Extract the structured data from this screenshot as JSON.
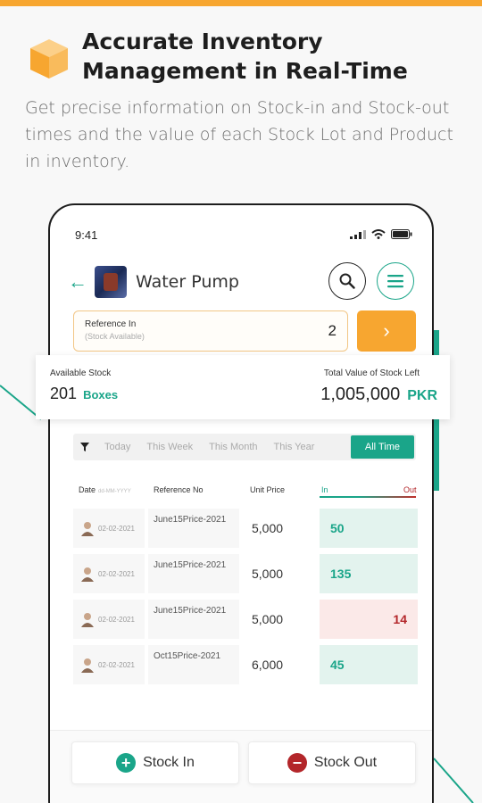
{
  "promo": {
    "headline_line1": "Accurate Inventory",
    "headline_line2": "Management in Real-Time",
    "subhead": "Get precise information on Stock-in and Stock-out times and the value of each Stock Lot and Product in inventory."
  },
  "phone": {
    "status_time": "9:41",
    "header": {
      "title": "Water Pump"
    },
    "reference": {
      "label": "Reference In",
      "sublabel": "(Stock Available)",
      "value": "2"
    },
    "stock": {
      "available_label": "Available Stock",
      "available_value": "201",
      "available_unit": "Boxes",
      "total_label": "Total Value of Stock Left",
      "total_value": "1,005,000",
      "total_unit": "PKR"
    },
    "filters": [
      "Today",
      "This Week",
      "This Month",
      "This Year",
      "All Time"
    ],
    "active_filter": "All Time",
    "table": {
      "headers": {
        "date": "Date",
        "date_format": "dd-MM-YYYY",
        "reference": "Reference No",
        "price": "Unit Price",
        "in": "In",
        "out": "Out"
      },
      "rows": [
        {
          "date": "02-02-2021",
          "reference": "June15Price-2021",
          "price": "5,000",
          "qty": "50",
          "direction": "in"
        },
        {
          "date": "02-02-2021",
          "reference": "June15Price-2021",
          "price": "5,000",
          "qty": "135",
          "direction": "in"
        },
        {
          "date": "02-02-2021",
          "reference": "June15Price-2021",
          "price": "5,000",
          "qty": "14",
          "direction": "out"
        },
        {
          "date": "02-02-2021",
          "reference": "Oct15Price-2021",
          "price": "6,000",
          "qty": "45",
          "direction": "in"
        }
      ]
    },
    "actions": {
      "stock_in": "Stock In",
      "stock_out": "Stock Out"
    }
  },
  "colors": {
    "accent_orange": "#f7a630",
    "accent_teal": "#1aa589",
    "out_red": "#b3262a"
  }
}
